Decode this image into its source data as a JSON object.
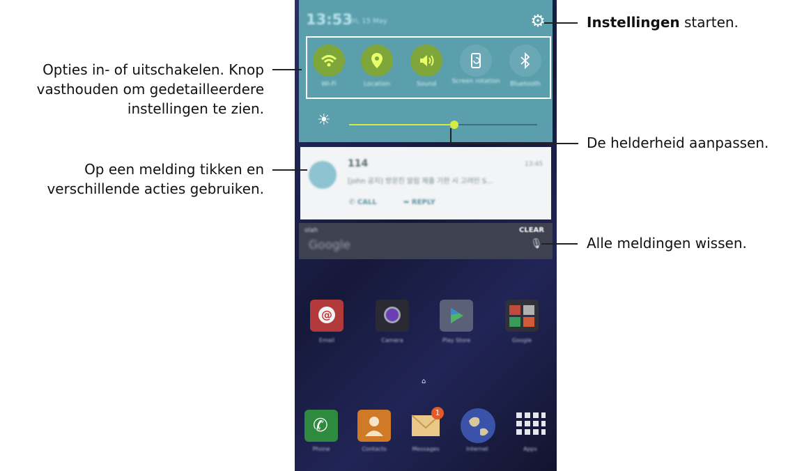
{
  "status_bar": {
    "time": "13:53",
    "date": "Fri, 15 May"
  },
  "quick_settings": [
    {
      "label": "Wi-Fi",
      "icon": "wifi-icon",
      "on": true
    },
    {
      "label": "Location",
      "icon": "location-icon",
      "on": true
    },
    {
      "label": "Sound",
      "icon": "sound-icon",
      "on": true
    },
    {
      "label": "Screen rotation",
      "icon": "screen-rotation-icon",
      "on": false
    },
    {
      "label": "Bluetooth",
      "icon": "bluetooth-icon",
      "on": false
    }
  ],
  "brightness": {
    "level": 0.56
  },
  "notification": {
    "title": "114",
    "time": "13:45",
    "body": "[john 공지] 방문진 알림 제출 기한 시 고려인 S...",
    "actions": [
      "CALL",
      "REPLY"
    ]
  },
  "clear_area": {
    "label": "olah",
    "search_brand": "Google",
    "clear_label": "CLEAR"
  },
  "apps_row1": [
    {
      "label": "Email",
      "icon": "email-icon"
    },
    {
      "label": "Camera",
      "icon": "camera-icon"
    },
    {
      "label": "Play Store",
      "icon": "play-store-icon"
    },
    {
      "label": "Google",
      "icon": "google-folder-icon"
    }
  ],
  "apps_row2": [
    {
      "label": "Phone",
      "icon": "phone-icon"
    },
    {
      "label": "Contacts",
      "icon": "contacts-icon"
    },
    {
      "label": "Messages",
      "icon": "messages-icon",
      "badge": "1"
    },
    {
      "label": "Internet",
      "icon": "internet-icon"
    },
    {
      "label": "Apps",
      "icon": "apps-grid-icon"
    }
  ],
  "callouts": {
    "settings_bold": "Instellingen",
    "settings_rest": " starten.",
    "toggle_line1": "Opties in- of uitschakelen. Knop",
    "toggle_line2": "vasthouden om gedetailleerdere",
    "toggle_line3": "instellingen te zien.",
    "brightness": "De helderheid aanpassen.",
    "notification_line1": "Op een melding tikken en",
    "notification_line2": "verschillende acties gebruiken.",
    "clear": "Alle meldingen wissen."
  }
}
